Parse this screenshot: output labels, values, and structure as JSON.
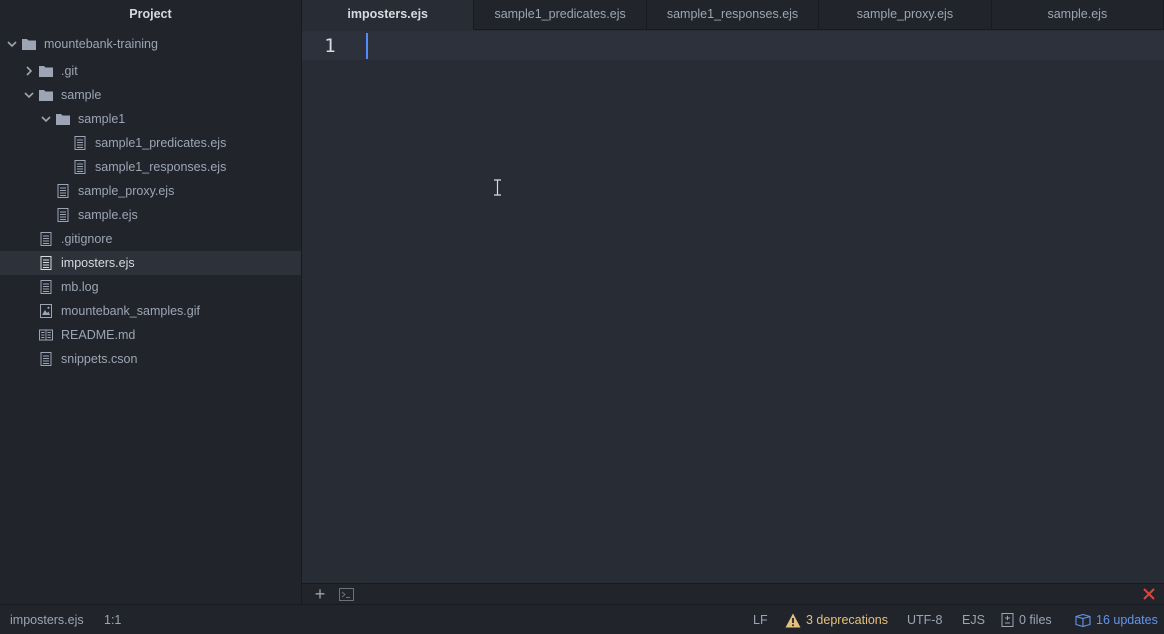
{
  "sidebar": {
    "title": "Project",
    "items": [
      {
        "label": "mountebank-training",
        "type": "folder",
        "expanded": true
      },
      {
        "label": ".git",
        "type": "folder",
        "expanded": false
      },
      {
        "label": "sample",
        "type": "folder",
        "expanded": true
      },
      {
        "label": "sample1",
        "type": "folder",
        "expanded": true
      },
      {
        "label": "sample1_predicates.ejs",
        "type": "file"
      },
      {
        "label": "sample1_responses.ejs",
        "type": "file"
      },
      {
        "label": "sample_proxy.ejs",
        "type": "file"
      },
      {
        "label": "sample.ejs",
        "type": "file"
      },
      {
        "label": ".gitignore",
        "type": "file"
      },
      {
        "label": "imposters.ejs",
        "type": "file",
        "selected": true
      },
      {
        "label": "mb.log",
        "type": "file"
      },
      {
        "label": "mountebank_samples.gif",
        "type": "image"
      },
      {
        "label": "README.md",
        "type": "readme"
      },
      {
        "label": "snippets.cson",
        "type": "file"
      }
    ]
  },
  "tabs": [
    {
      "label": "imposters.ejs",
      "active": true
    },
    {
      "label": "sample1_predicates.ejs",
      "active": false
    },
    {
      "label": "sample1_responses.ejs",
      "active": false
    },
    {
      "label": "sample_proxy.ejs",
      "active": false
    },
    {
      "label": "sample.ejs",
      "active": false
    }
  ],
  "editor": {
    "line_number": "1"
  },
  "status": {
    "file": "imposters.ejs",
    "cursor": "1:1",
    "line_ending": "LF",
    "deprecations": "3 deprecations",
    "encoding": "UTF-8",
    "grammar": "EJS",
    "files": "0 files",
    "updates": "16 updates"
  },
  "colors": {
    "accent": "#528bff",
    "warning": "#e5c07b",
    "updates": "#6494ed",
    "error": "#e0443e"
  }
}
